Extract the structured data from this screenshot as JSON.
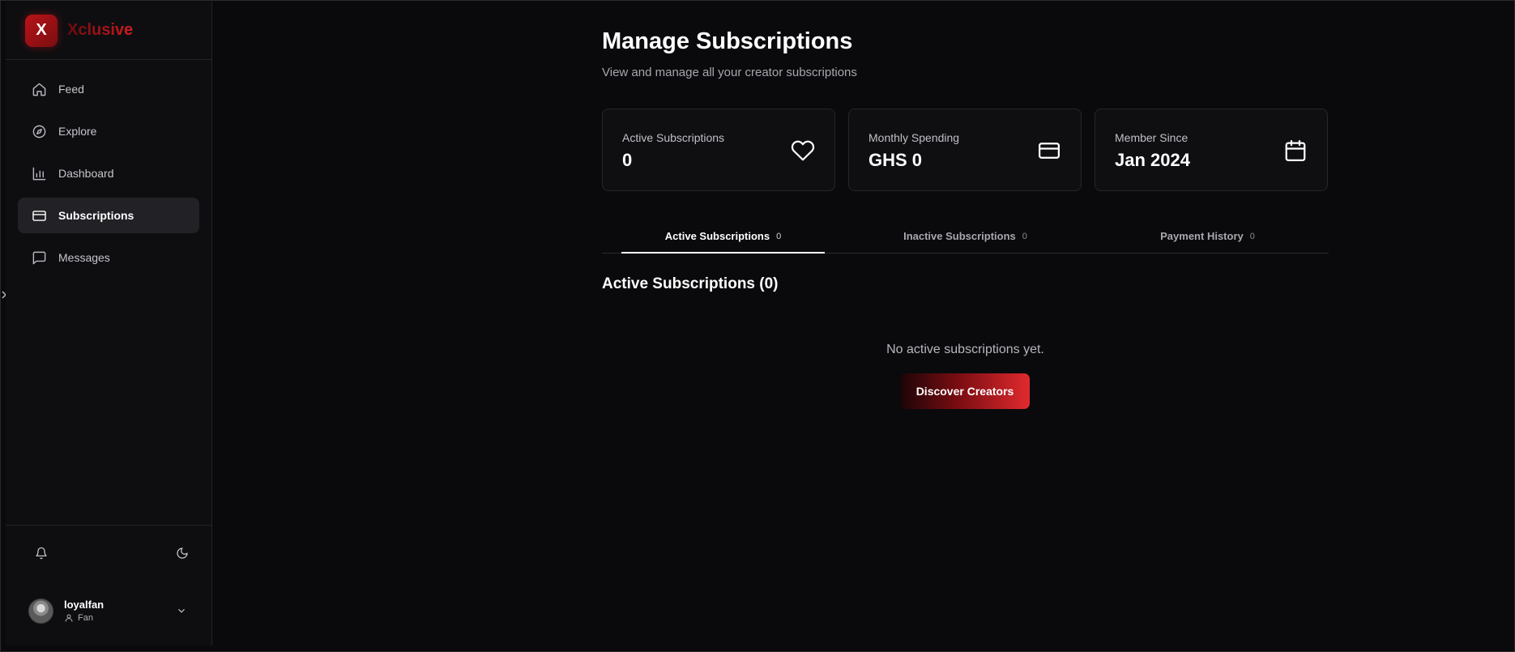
{
  "brand": {
    "logo_letter": "X",
    "name": "Xclusive"
  },
  "sidebar": {
    "items": [
      {
        "label": "Feed",
        "icon": "home-icon"
      },
      {
        "label": "Explore",
        "icon": "compass-icon"
      },
      {
        "label": "Dashboard",
        "icon": "bar-chart-icon"
      },
      {
        "label": "Subscriptions",
        "icon": "credit-card-icon",
        "active": true
      },
      {
        "label": "Messages",
        "icon": "message-square-icon"
      }
    ]
  },
  "user": {
    "name": "loyalfan",
    "role": "Fan"
  },
  "page": {
    "title": "Manage Subscriptions",
    "subtitle": "View and manage all your creator subscriptions"
  },
  "stats": [
    {
      "label": "Active Subscriptions",
      "value": "0",
      "icon": "heart-icon"
    },
    {
      "label": "Monthly Spending",
      "value": "GHS 0",
      "icon": "credit-card-icon"
    },
    {
      "label": "Member Since",
      "value": "Jan 2024",
      "icon": "calendar-icon"
    }
  ],
  "tabs": [
    {
      "label": "Active Subscriptions",
      "count": "0",
      "active": true
    },
    {
      "label": "Inactive Subscriptions",
      "count": "0"
    },
    {
      "label": "Payment History",
      "count": "0"
    }
  ],
  "content": {
    "section_title": "Active Subscriptions (0)",
    "empty_text": "No active subscriptions yet.",
    "cta_label": "Discover Creators"
  },
  "colors": {
    "accent": "#e02a2e",
    "background": "#0a0a0d",
    "sidebar": "#0e0e11"
  }
}
